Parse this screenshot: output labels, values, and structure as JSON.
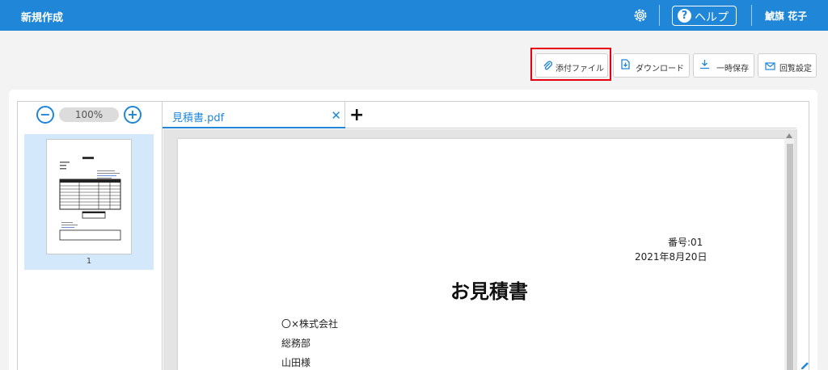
{
  "header": {
    "title": "新規作成",
    "help_label": "ヘルプ",
    "help_icon": "?",
    "user_name": "鯱旗 花子"
  },
  "toolbar": {
    "attach_label": "添付ファイル",
    "download_label": "ダウンロード",
    "save_label": "一時保存",
    "route_label": "回覧設定"
  },
  "thumbnails": {
    "zoom_out": "−",
    "zoom_in": "+",
    "zoom_level": "100%",
    "page_number": "1"
  },
  "tabs": {
    "active_label": "見積書.pdf",
    "close_glyph": "✕",
    "add_glyph": "+"
  },
  "document": {
    "number": "番号:01",
    "date": "2021年8月20日",
    "title": "お見積書",
    "company": "〇×株式会社",
    "department": "総務部",
    "addressee": "山田様"
  },
  "colors": {
    "accent": "#1f86d8",
    "highlight": "#e60012"
  }
}
